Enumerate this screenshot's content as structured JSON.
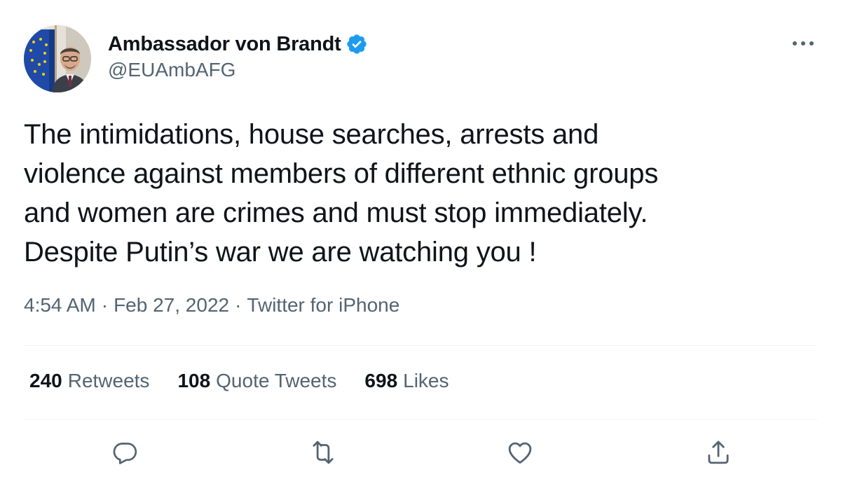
{
  "author": {
    "display_name": "Ambassador von Brandt",
    "handle": "@EUAmbAFG",
    "verified": true
  },
  "tweet": {
    "text": "The intimidations, house searches, arrests and\nviolence against members of different ethnic groups\nand women are crimes and must stop immediately.\nDespite Putin’s war we are watching you !"
  },
  "meta": {
    "time": "4:54 AM",
    "separator": "·",
    "date": "Feb 27, 2022",
    "source": "Twitter for iPhone"
  },
  "stats": {
    "retweets_count": "240",
    "retweets_label": "Retweets",
    "quotes_count": "108",
    "quotes_label": "Quote Tweets",
    "likes_count": "698",
    "likes_label": "Likes"
  },
  "icons": {
    "more": "more-horizontal-icon",
    "reply": "reply-icon",
    "retweet": "retweet-icon",
    "like": "heart-icon",
    "share": "share-icon",
    "verified": "verified-badge-icon"
  },
  "colors": {
    "text_primary": "#0f1419",
    "text_secondary": "#536471",
    "verified": "#1d9bf0",
    "divider": "#eff3f4"
  }
}
